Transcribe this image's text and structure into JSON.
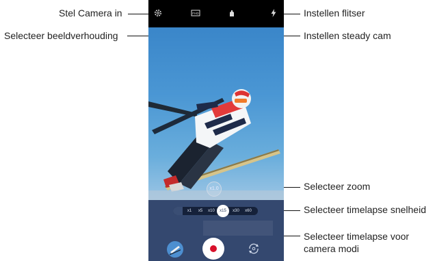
{
  "callouts": {
    "settings": "Stel Camera in",
    "aspect_ratio": "Selecteer beeldverhouding",
    "flash": "Instellen flitser",
    "steady_cam": "Instellen steady cam",
    "zoom": "Selecteer zoom",
    "timelapse_speed": "Selecteer timelapse snelheid",
    "timelapse_modes_line1": "Selecteer timelapse voor",
    "timelapse_modes_line2": "camera modi"
  },
  "camera": {
    "topbar_icons": [
      "gear-icon",
      "aspect-ratio-icon",
      "steady-cam-icon",
      "flash-icon"
    ],
    "aspect_label": "FHD",
    "zoom_label": "x1.0",
    "speed_options": [
      "x1",
      "x5",
      "x10",
      "x15",
      "x30",
      "x60"
    ],
    "selected_speed": "x15",
    "colors": {
      "record": "#d8102b",
      "topbar": "#000000",
      "bottom_panel": "#34486f"
    }
  }
}
